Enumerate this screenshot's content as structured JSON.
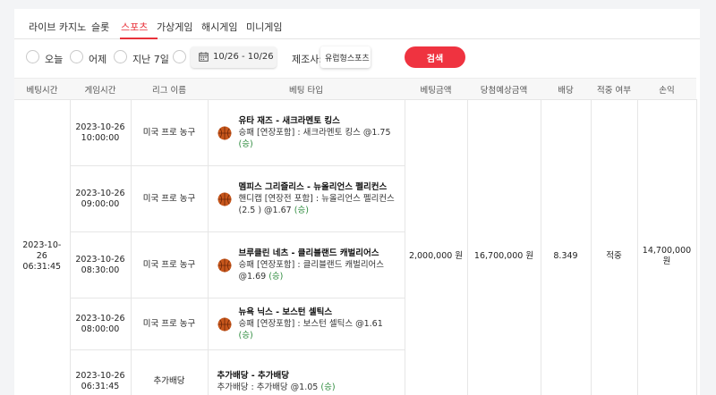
{
  "tabs": [
    {
      "label": "라이브 카지노",
      "active": false
    },
    {
      "label": "슬롯",
      "active": false
    },
    {
      "label": "스포츠",
      "active": true
    },
    {
      "label": "가상게임",
      "active": false
    },
    {
      "label": "해시게임",
      "active": false
    },
    {
      "label": "미니게임",
      "active": false
    }
  ],
  "filters": {
    "radios": [
      {
        "label": "오늘"
      },
      {
        "label": "어제"
      },
      {
        "label": "지난 7일"
      }
    ],
    "date_range": "10/26 - 10/26",
    "maker_label": "제조사:",
    "maker_value": "유럽형스포츠",
    "search_label": "검색"
  },
  "table": {
    "headers": [
      "베팅시간",
      "게임시간",
      "리그 이름",
      "베팅 타입",
      "베팅금액",
      "당첨예상금액",
      "배당",
      "적중 여부",
      "손익"
    ],
    "bet_time": "2023-10-26\n06:31:45",
    "bet_amount": "2,000,000 원",
    "expected_win": "16,700,000 원",
    "odds": "8.349",
    "hit_status": "적중",
    "profit": "14,700,000 원",
    "rows": [
      {
        "game_time": "2023-10-26\n10:00:00",
        "league": "미국 프로 농구",
        "icon": "basketball-icon",
        "match": "유타 재즈 - 새크라멘토 킹스",
        "pick": "승패 [연장포함] : 새크라멘토 킹스 @1.75",
        "result": "(승)"
      },
      {
        "game_time": "2023-10-26\n09:00:00",
        "league": "미국 프로 농구",
        "icon": "basketball-icon",
        "match": "멤피스 그리즐리스 - 뉴올리언스 펠리컨스",
        "pick": "핸디캡 [연장전 포함] : 뉴올리언스 펠리컨스 (2.5 ) @1.67",
        "result": "(승)"
      },
      {
        "game_time": "2023-10-26\n08:30:00",
        "league": "미국 프로 농구",
        "icon": "basketball-icon",
        "match": "브루클린 네츠 - 클리블랜드 캐벌리어스",
        "pick": "승패 [연장포함] : 클리블랜드 캐벌리어스 @1.69",
        "result": "(승)"
      },
      {
        "game_time": "2023-10-26\n08:00:00",
        "league": "미국 프로 농구",
        "icon": "basketball-icon",
        "match": "뉴욕 닉스 - 보스턴 셀틱스",
        "pick": "승패 [연장포함] : 보스턴 셀틱스 @1.61",
        "result": "(승)"
      },
      {
        "game_time": "2023-10-26\n06:31:45",
        "league": "추가배당",
        "icon": "",
        "match": "추가배당 - 추가배당",
        "pick": "추가배당 : 추가배당 @1.05",
        "result": "(승)"
      }
    ]
  },
  "colors": {
    "accent": "#ef3340",
    "success": "#2e8b3e",
    "ball": "#c8571c",
    "scrollbar": "#c7a582"
  }
}
